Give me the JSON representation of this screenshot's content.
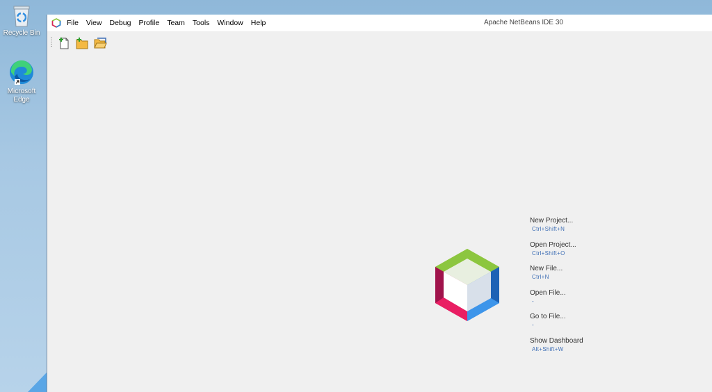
{
  "desktop": {
    "icons": [
      {
        "label": "Recycle Bin"
      },
      {
        "label": "Microsoft Edge"
      }
    ]
  },
  "window": {
    "title": "Apache NetBeans IDE 30",
    "menu": [
      "File",
      "View",
      "Debug",
      "Profile",
      "Team",
      "Tools",
      "Window",
      "Help"
    ]
  },
  "toolbar": {
    "buttons": [
      "new-file",
      "new-project",
      "open-project"
    ]
  },
  "welcome": {
    "actions": [
      {
        "label": "New Project...",
        "shortcut": "Ctrl+Shift+N"
      },
      {
        "label": "Open Project...",
        "shortcut": "Ctrl+Shift+O"
      },
      {
        "label": "New File...",
        "shortcut": "Ctrl+N"
      },
      {
        "label": "Open File...",
        "shortcut": "-"
      },
      {
        "label": "Go to File...",
        "shortcut": "-"
      },
      {
        "label": "Show Dashboard",
        "shortcut": "Alt+Shift+W"
      }
    ]
  }
}
